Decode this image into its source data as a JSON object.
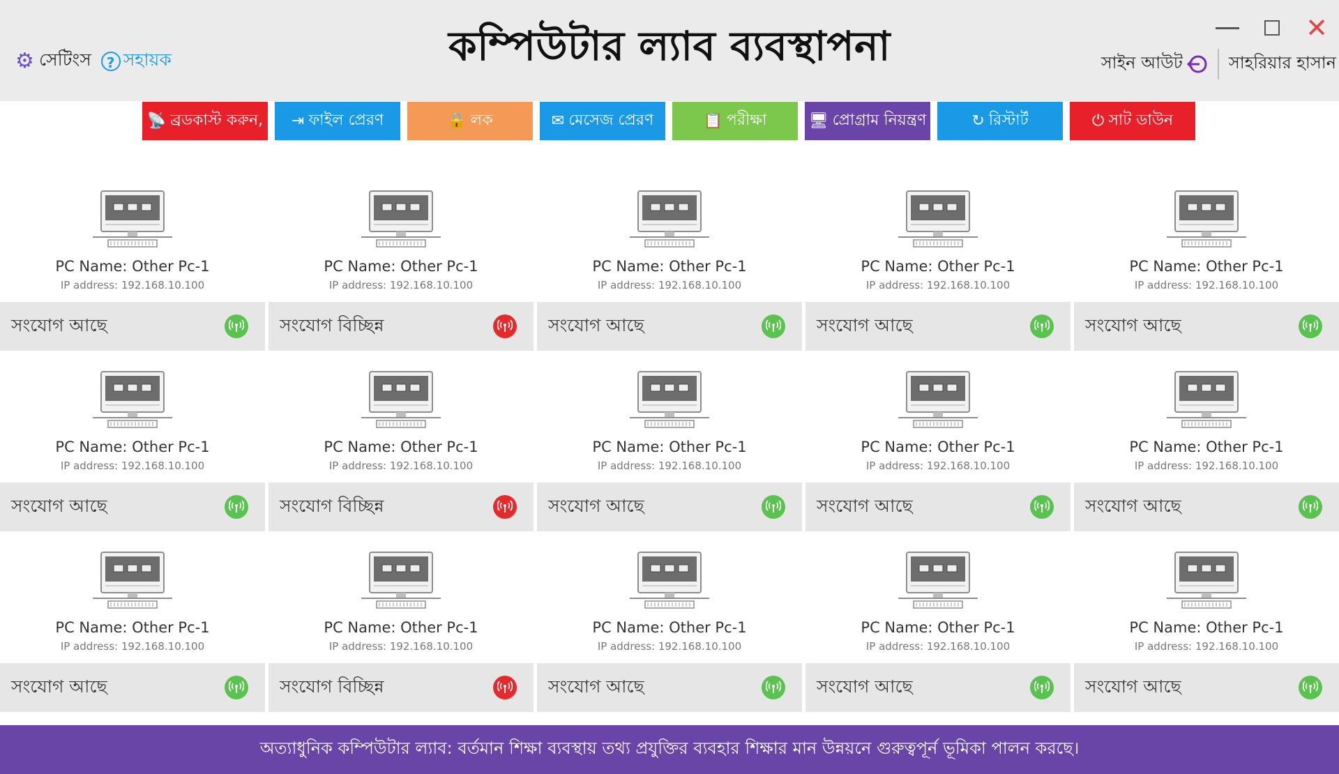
{
  "header": {
    "title": "কম্পিউটার ল্যাব ব্যবস্থাপনা",
    "settings_label": "সেটিংস",
    "help_label": "সহায়ক",
    "signout_label": "সাইন আউট",
    "user_name": "সাহরিয়ার হাসান"
  },
  "toolbar": [
    {
      "label": "ব্রডকাস্ট করুন,",
      "color": "#e8202a",
      "icon": "broadcast-icon",
      "glyph": "📡"
    },
    {
      "label": "ফাইল প্রেরণ",
      "color": "#1a9ae6",
      "icon": "file-send-icon",
      "glyph": "⇥"
    },
    {
      "label": "লক",
      "color": "#f59a56",
      "icon": "lock-icon",
      "glyph": "🔒"
    },
    {
      "label": "মেসেজ প্রেরণ",
      "color": "#1a9ae6",
      "icon": "message-icon",
      "glyph": "✉"
    },
    {
      "label": "পরীক্ষা",
      "color": "#7bc84c",
      "icon": "exam-icon",
      "glyph": "📋"
    },
    {
      "label": "প্রোগ্রাম নিয়ন্ত্রণ",
      "color": "#6a45a8",
      "icon": "program-control-icon",
      "glyph": "🖥"
    },
    {
      "label": "রিস্টার্ট",
      "color": "#1a9ae6",
      "icon": "restart-icon",
      "glyph": "↻"
    },
    {
      "label": "সাট ডাউন",
      "color": "#e8202a",
      "icon": "power-icon",
      "glyph": "⏻"
    }
  ],
  "pcs": [
    {
      "name": "PC Name: Other Pc-1",
      "ip": "IP address: 192.168.10.100",
      "status": "সংযোগ আছে",
      "connected": true
    },
    {
      "name": "PC Name: Other Pc-1",
      "ip": "IP address: 192.168.10.100",
      "status": "সংযোগ বিচ্ছিন্ন",
      "connected": false
    },
    {
      "name": "PC Name: Other Pc-1",
      "ip": "IP address: 192.168.10.100",
      "status": "সংযোগ আছে",
      "connected": true
    },
    {
      "name": "PC Name: Other Pc-1",
      "ip": "IP address: 192.168.10.100",
      "status": "সংযোগ আছে",
      "connected": true
    },
    {
      "name": "PC Name: Other Pc-1",
      "ip": "IP address: 192.168.10.100",
      "status": "সংযোগ আছে",
      "connected": true
    },
    {
      "name": "PC Name: Other Pc-1",
      "ip": "IP address: 192.168.10.100",
      "status": "সংযোগ আছে",
      "connected": true
    },
    {
      "name": "PC Name: Other Pc-1",
      "ip": "IP address: 192.168.10.100",
      "status": "সংযোগ বিচ্ছিন্ন",
      "connected": false
    },
    {
      "name": "PC Name: Other Pc-1",
      "ip": "IP address: 192.168.10.100",
      "status": "সংযোগ আছে",
      "connected": true
    },
    {
      "name": "PC Name: Other Pc-1",
      "ip": "IP address: 192.168.10.100",
      "status": "সংযোগ আছে",
      "connected": true
    },
    {
      "name": "PC Name: Other Pc-1",
      "ip": "IP address: 192.168.10.100",
      "status": "সংযোগ আছে",
      "connected": true
    },
    {
      "name": "PC Name: Other Pc-1",
      "ip": "IP address: 192.168.10.100",
      "status": "সংযোগ আছে",
      "connected": true
    },
    {
      "name": "PC Name: Other Pc-1",
      "ip": "IP address: 192.168.10.100",
      "status": "সংযোগ বিচ্ছিন্ন",
      "connected": false
    },
    {
      "name": "PC Name: Other Pc-1",
      "ip": "IP address: 192.168.10.100",
      "status": "সংযোগ আছে",
      "connected": true
    },
    {
      "name": "PC Name: Other Pc-1",
      "ip": "IP address: 192.168.10.100",
      "status": "সংযোগ আছে",
      "connected": true
    },
    {
      "name": "PC Name: Other Pc-1",
      "ip": "IP address: 192.168.10.100",
      "status": "সংযোগ আছে",
      "connected": true
    }
  ],
  "footer": {
    "text": "অত্যাধুনিক কম্পিউটার ল্যাব: বর্তমান শিক্ষা ব্যবস্থায় তথ্য প্রযুক্তির ব্যবহার শিক্ষার মান উন্নয়নে গুরুত্বপূর্ন ভূমিকা পালন করছে।"
  },
  "colors": {
    "connected": "#5ac24f",
    "disconnected": "#e42a2a",
    "accent_purple": "#6a45a8",
    "accent_blue": "#1a9ae6"
  }
}
